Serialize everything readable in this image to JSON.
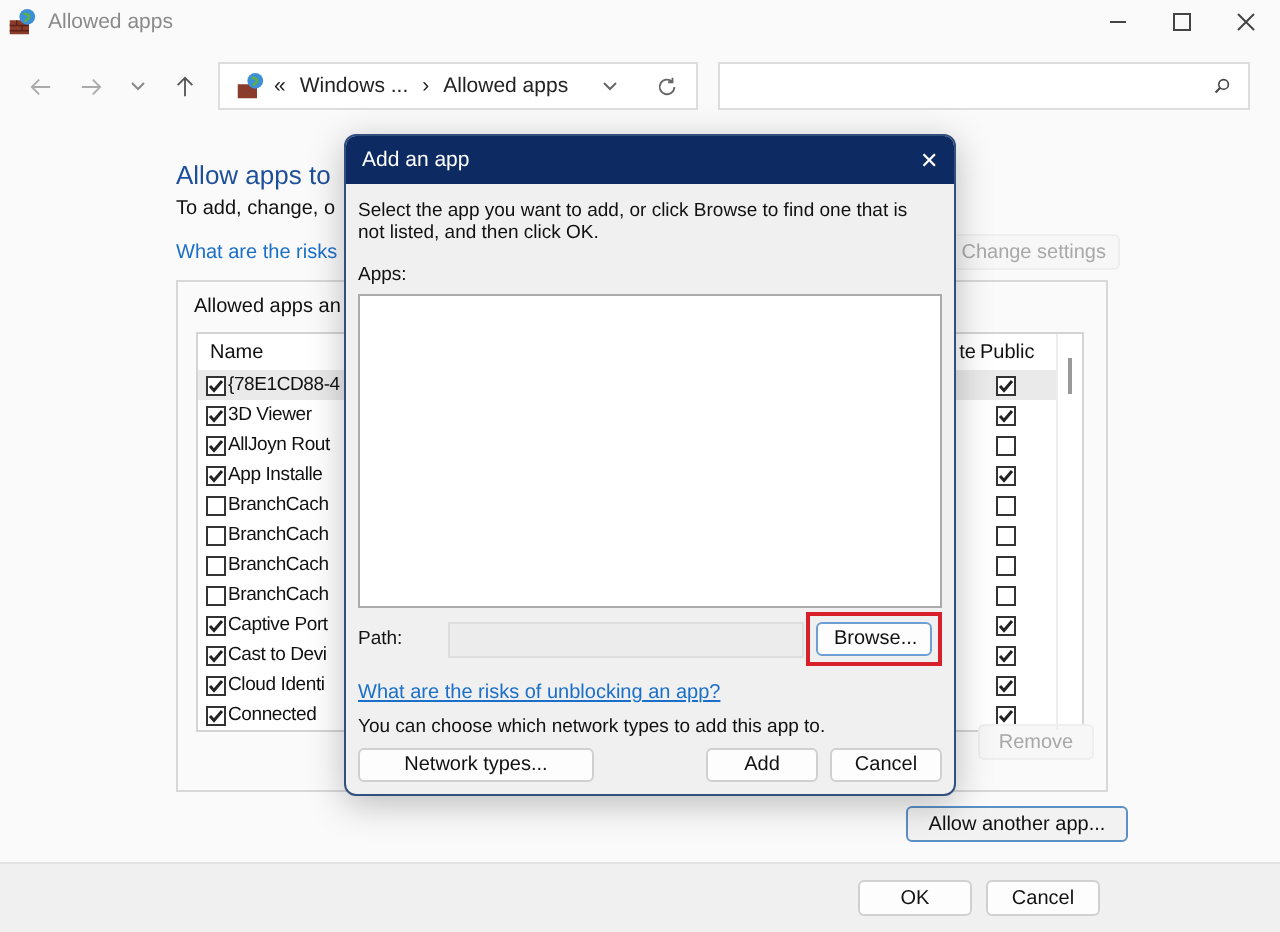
{
  "window": {
    "title": "Allowed apps"
  },
  "address_bar": {
    "prefix": "«",
    "crumbs": [
      "Windows ...",
      "Allowed apps"
    ],
    "separator": "›"
  },
  "heading": "Allow apps to",
  "description": "To add, change, o",
  "risks_link": "What are the risks",
  "change_settings": {
    "label": "Change settings",
    "disabled": true
  },
  "group": {
    "label": "Allowed apps an",
    "columns": [
      "Name",
      "te",
      "Public"
    ],
    "rows": [
      {
        "name": "{78E1CD88-4",
        "checked": true,
        "public": true,
        "selected": true
      },
      {
        "name": "3D Viewer",
        "checked": true,
        "public": true,
        "selected": false
      },
      {
        "name": "AllJoyn Rout",
        "checked": true,
        "public": false,
        "selected": false
      },
      {
        "name": "App Installe",
        "checked": true,
        "public": true,
        "selected": false
      },
      {
        "name": "BranchCach",
        "checked": false,
        "public": false,
        "selected": false
      },
      {
        "name": "BranchCach",
        "checked": false,
        "public": false,
        "selected": false
      },
      {
        "name": "BranchCach",
        "checked": false,
        "public": false,
        "selected": false
      },
      {
        "name": "BranchCach",
        "checked": false,
        "public": false,
        "selected": false
      },
      {
        "name": "Captive Port",
        "checked": true,
        "public": true,
        "selected": false
      },
      {
        "name": "Cast to Devi",
        "checked": true,
        "public": true,
        "selected": false
      },
      {
        "name": "Cloud Identi",
        "checked": true,
        "public": true,
        "selected": false
      },
      {
        "name": "Connected",
        "checked": true,
        "public": true,
        "selected": false
      }
    ]
  },
  "remove_button": {
    "label": "Remove",
    "disabled": true
  },
  "allow_button": {
    "label": "Allow another app...",
    "disabled": false
  },
  "footer_buttons": [
    "OK",
    "Cancel"
  ],
  "dialog": {
    "title": "Add an app",
    "close": "✕",
    "instruction": "Select the app you want to add, or click Browse to find one that is not listed, and then click OK.",
    "apps_label": "Apps:",
    "path_label": "Path:",
    "browse_button": {
      "label": "Browse...",
      "highlighted": true
    },
    "link": "What are the risks of unblocking an app?",
    "note": "You can choose which network types to add this app to.",
    "buttons": [
      {
        "label": "Network types...",
        "kind": "left"
      },
      {
        "label": "Add",
        "kind": "right"
      },
      {
        "label": "Cancel",
        "kind": "right"
      }
    ]
  }
}
